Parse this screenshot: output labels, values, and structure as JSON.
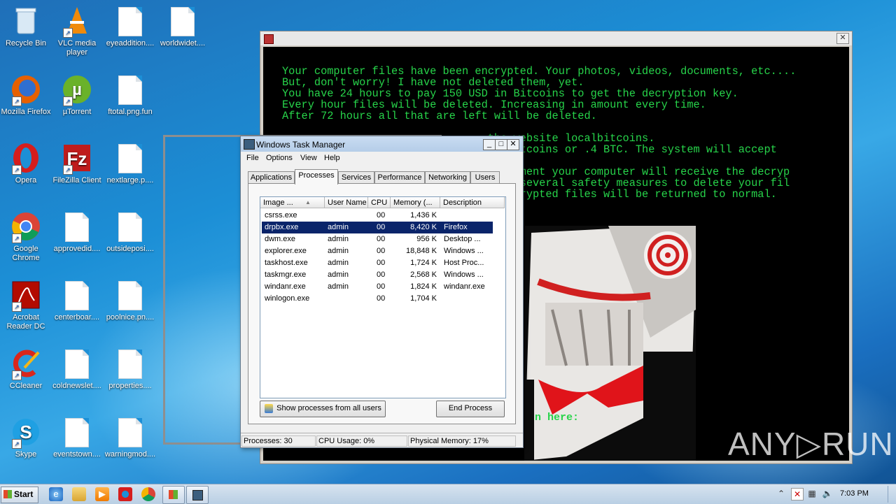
{
  "desktop": {
    "icons": [
      {
        "label": "Recycle Bin",
        "icon": "recycle-bin-icon"
      },
      {
        "label": "VLC media player",
        "icon": "vlc-icon"
      },
      {
        "label": "eyeaddition....",
        "icon": "file-icon"
      },
      {
        "label": "worldwidet....",
        "icon": "file-icon"
      },
      {
        "label": "Mozilla Firefox",
        "icon": "firefox-icon"
      },
      {
        "label": "µTorrent",
        "icon": "utorrent-icon"
      },
      {
        "label": "ftotal.png.fun",
        "icon": "file-icon"
      },
      {
        "label": "Opera",
        "icon": "opera-icon"
      },
      {
        "label": "FileZilla Client",
        "icon": "filezilla-icon"
      },
      {
        "label": "nextlarge.p....",
        "icon": "file-icon"
      },
      {
        "label": "Google Chrome",
        "icon": "chrome-icon"
      },
      {
        "label": "approvedid....",
        "icon": "file-icon"
      },
      {
        "label": "outsideposi....",
        "icon": "file-icon"
      },
      {
        "label": "Acrobat Reader DC",
        "icon": "acrobat-icon"
      },
      {
        "label": "centerboar....",
        "icon": "file-icon"
      },
      {
        "label": "poolnice.pn....",
        "icon": "file-icon"
      },
      {
        "label": "CCleaner",
        "icon": "ccleaner-icon"
      },
      {
        "label": "coldnewslet....",
        "icon": "file-icon"
      },
      {
        "label": "properties....",
        "icon": "file-icon"
      },
      {
        "label": "Skype",
        "icon": "skype-icon"
      },
      {
        "label": "eventstown....",
        "icon": "file-icon"
      },
      {
        "label": "warningmod....",
        "icon": "file-icon"
      }
    ]
  },
  "ransom_window": {
    "close_glyph": "✕",
    "message": "Your computer files have been encrypted. Your photos, videos, documents, etc....\nBut, don't worry! I have not deleted them, yet.\nYou have 24 hours to pay 150 USD in Bitcoins to get the decryption key.\nEvery hour files will be deleted. Increasing in amount every time.\nAfter 72 hours all that are left will be deleted.\n\n                                the website localbitcoins.\n                                of Bitcoins or .4 BTC. The system will accept\n                                fied.\n                                r payment your computer will receive the decryp\n                                 has several safety measures to delete your fil\n                                the crypted files will be returned to normal.",
    "input_prompt": "n here:"
  },
  "task_manager": {
    "title": "Windows Task Manager",
    "window_buttons": {
      "minimize": "_",
      "maximize": "□",
      "close": "✕"
    },
    "menu": [
      "File",
      "Options",
      "View",
      "Help"
    ],
    "tabs": [
      "Applications",
      "Processes",
      "Services",
      "Performance",
      "Networking",
      "Users"
    ],
    "active_tab": "Processes",
    "columns": [
      "Image ...",
      "User Name",
      "CPU",
      "Memory (...",
      "Description"
    ],
    "sort_glyph": "▲",
    "rows": [
      {
        "image": "csrss.exe",
        "user": "",
        "cpu": "00",
        "memory": "1,436 K",
        "desc": ""
      },
      {
        "image": "drpbx.exe",
        "user": "admin",
        "cpu": "00",
        "memory": "8,420 K",
        "desc": "Firefox"
      },
      {
        "image": "dwm.exe",
        "user": "admin",
        "cpu": "00",
        "memory": "956 K",
        "desc": "Desktop ..."
      },
      {
        "image": "explorer.exe",
        "user": "admin",
        "cpu": "00",
        "memory": "18,848 K",
        "desc": "Windows ..."
      },
      {
        "image": "taskhost.exe",
        "user": "admin",
        "cpu": "00",
        "memory": "1,724 K",
        "desc": "Host Proc..."
      },
      {
        "image": "taskmgr.exe",
        "user": "admin",
        "cpu": "00",
        "memory": "2,568 K",
        "desc": "Windows ..."
      },
      {
        "image": "windanr.exe",
        "user": "admin",
        "cpu": "00",
        "memory": "1,824 K",
        "desc": "windanr.exe"
      },
      {
        "image": "winlogon.exe",
        "user": "",
        "cpu": "00",
        "memory": "1,704 K",
        "desc": ""
      }
    ],
    "selected_row": 1,
    "show_all_button": "Show processes from all users",
    "end_process_button": "End Process",
    "status": {
      "processes": "Processes: 30",
      "cpu": "CPU Usage: 0%",
      "memory": "Physical Memory: 17%"
    }
  },
  "taskbar": {
    "start_label": "Start",
    "tray_expand_glyph": "⌃",
    "volume_glyph": "🔈",
    "clock": "7:03 PM"
  },
  "watermark": "ANY▷RUN"
}
